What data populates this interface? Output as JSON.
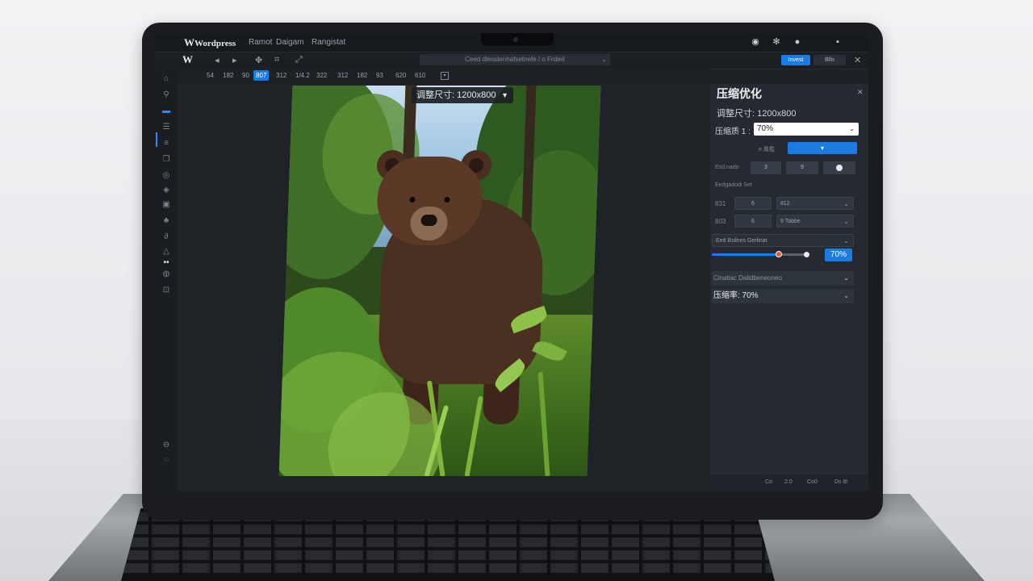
{
  "app": {
    "logo_mark": "W",
    "logo_text": "Wordpress",
    "menu": [
      "Ramot",
      "Daigam",
      "Rangistat"
    ],
    "file_path": "Ceed dleisdenhafsetnefe / o Frdieil",
    "save_label": "Invest",
    "secondary_label": "Bllo"
  },
  "zoom_tabs": [
    "54",
    "182",
    "90",
    "807",
    "312",
    "1/4.2",
    "322",
    "312",
    "182",
    "93",
    "620",
    "610"
  ],
  "zoom_active_index": 3,
  "canvas": {
    "resize_badge": "调整尺寸: 1200x800"
  },
  "panel": {
    "title": "压缩优化",
    "size_label": "调整尺寸: 1200x800",
    "quality_label": "压缩质 1 :",
    "quality_value": "70%",
    "mode_label": "e.鳳檻",
    "row1_label": "Esd.nado",
    "row1_vals": [
      "3",
      "9"
    ],
    "section_label": "Eedgadodi Set",
    "row2_label": "831",
    "row2_vals": [
      "6",
      "812"
    ],
    "row3_label": "803",
    "row3_vals": [
      "6",
      "9 Tabbe"
    ],
    "dropdown_label": "Eed Bsilnes Gerlinat",
    "slider_value_pct": 70,
    "slider_badge": "70%",
    "accordion_label": "Cinatiac Dalidbeneoneo",
    "compress_label": "压缩率: 70%",
    "footer_items": [
      "Co",
      "2.0",
      "Co0",
      "Ds 6t"
    ]
  },
  "colors": {
    "accent": "#1a7be0",
    "slider_knob": "#e25b3a"
  }
}
